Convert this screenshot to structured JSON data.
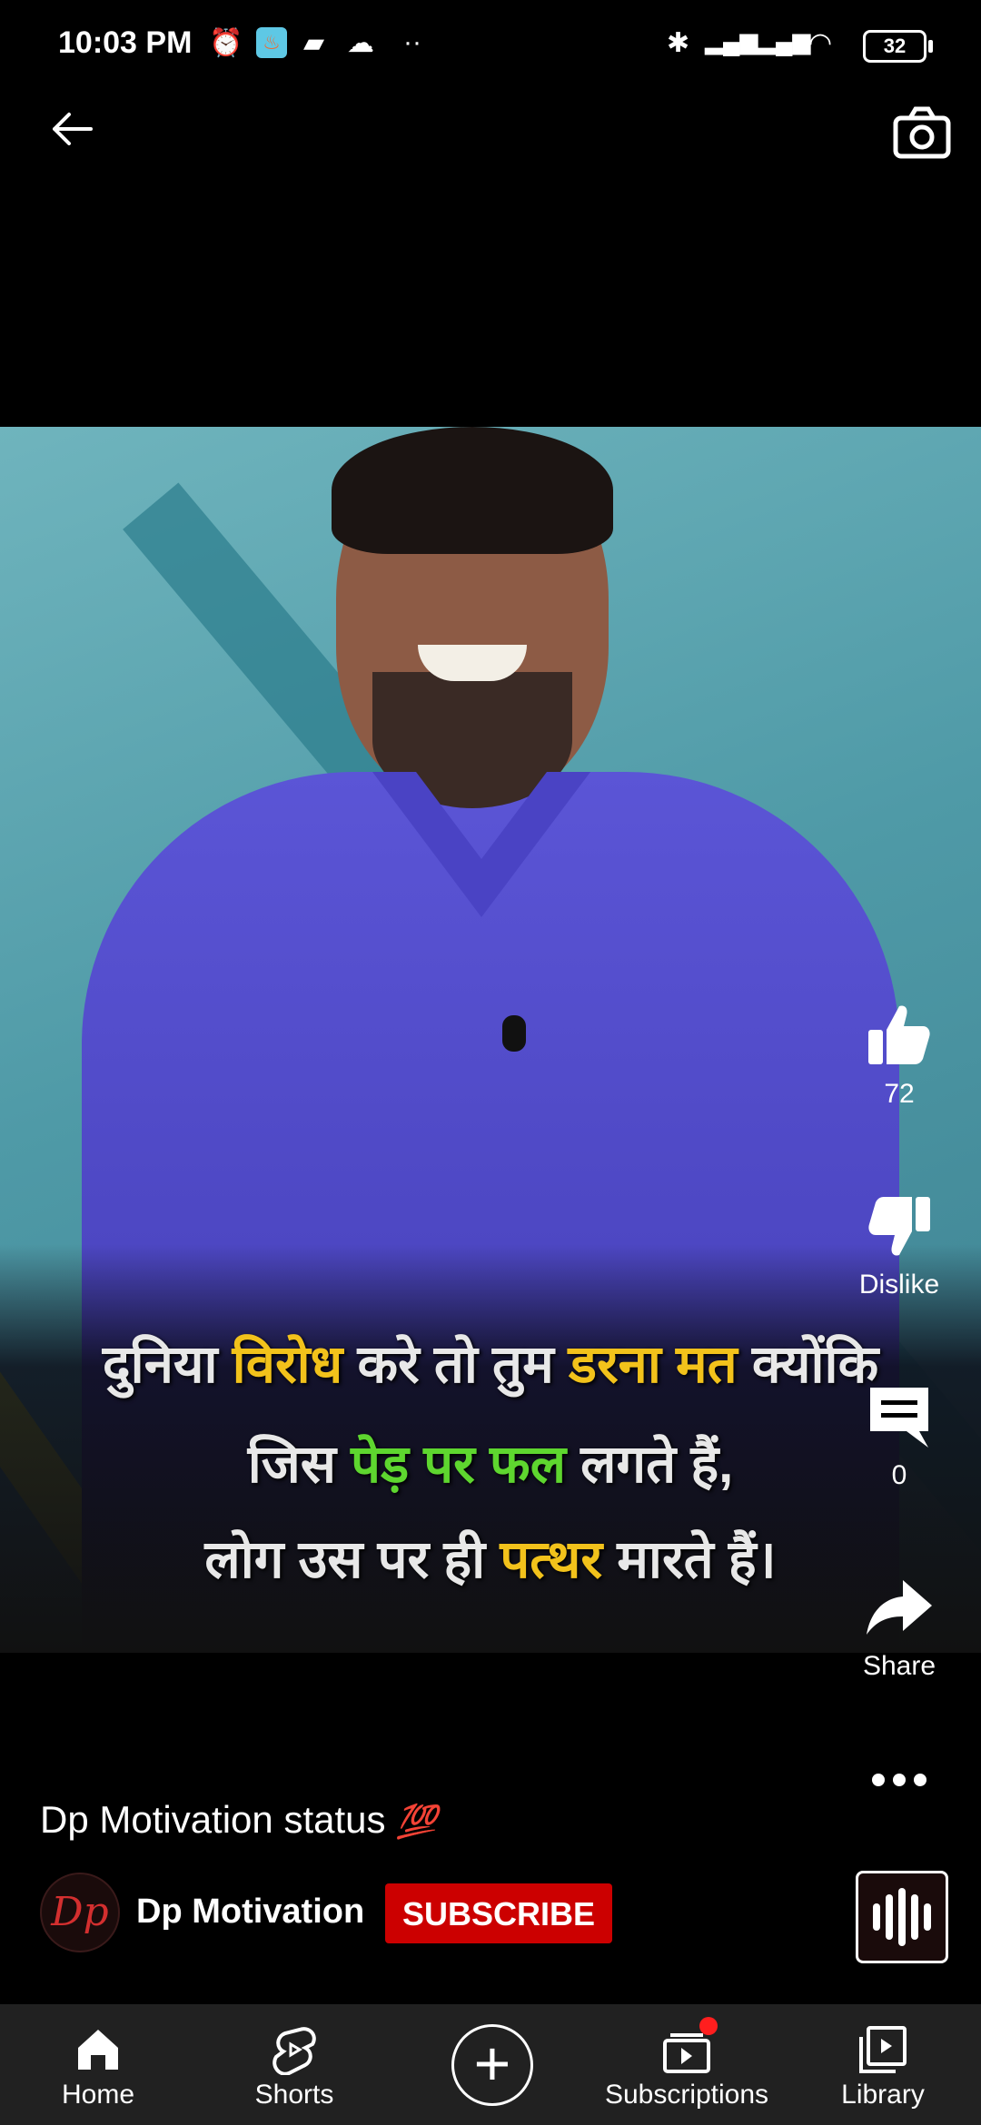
{
  "status_bar": {
    "time": "10:03 PM",
    "battery": "32",
    "icons": [
      "alarm-icon",
      "app-notification-icon",
      "message-icon",
      "cloud-icon",
      "more-dots-icon",
      "bluetooth-icon",
      "signal-icon",
      "signal-roaming-icon",
      "wifi-icon"
    ]
  },
  "top_bar": {
    "back_icon": "back-arrow-icon",
    "camera_icon": "camera-icon"
  },
  "video": {
    "caption_lines": [
      [
        {
          "text": "दुनिया ",
          "color": "white"
        },
        {
          "text": "विरोध",
          "color": "yellow"
        },
        {
          "text": " करे तो तुम ",
          "color": "white"
        },
        {
          "text": "डरना मत",
          "color": "yellow"
        },
        {
          "text": " क्योंकि",
          "color": "white"
        }
      ],
      [
        {
          "text": "जिस ",
          "color": "white"
        },
        {
          "text": "पेड़ पर फल",
          "color": "green"
        },
        {
          "text": " लगते हैं,",
          "color": "white"
        }
      ],
      [
        {
          "text": "लोग उस पर ही ",
          "color": "white"
        },
        {
          "text": "पत्थर",
          "color": "yellow"
        },
        {
          "text": " मारते हैं।",
          "color": "white"
        }
      ]
    ]
  },
  "actions": {
    "like_count": "72",
    "dislike_label": "Dislike",
    "comment_count": "0",
    "share_label": "Share"
  },
  "info": {
    "title": "Dp Motivation status",
    "title_emoji": "💯",
    "channel_name": "Dp Motivation",
    "avatar_text": "Dp",
    "subscribe_label": "SUBSCRIBE"
  },
  "nav": {
    "home": "Home",
    "shorts": "Shorts",
    "subscriptions": "Subscriptions",
    "library": "Library"
  },
  "colors": {
    "subscribe": "#cc0000",
    "caption_yellow": "#f2c21b",
    "caption_green": "#5ed62f",
    "nav_bg": "#212121"
  }
}
